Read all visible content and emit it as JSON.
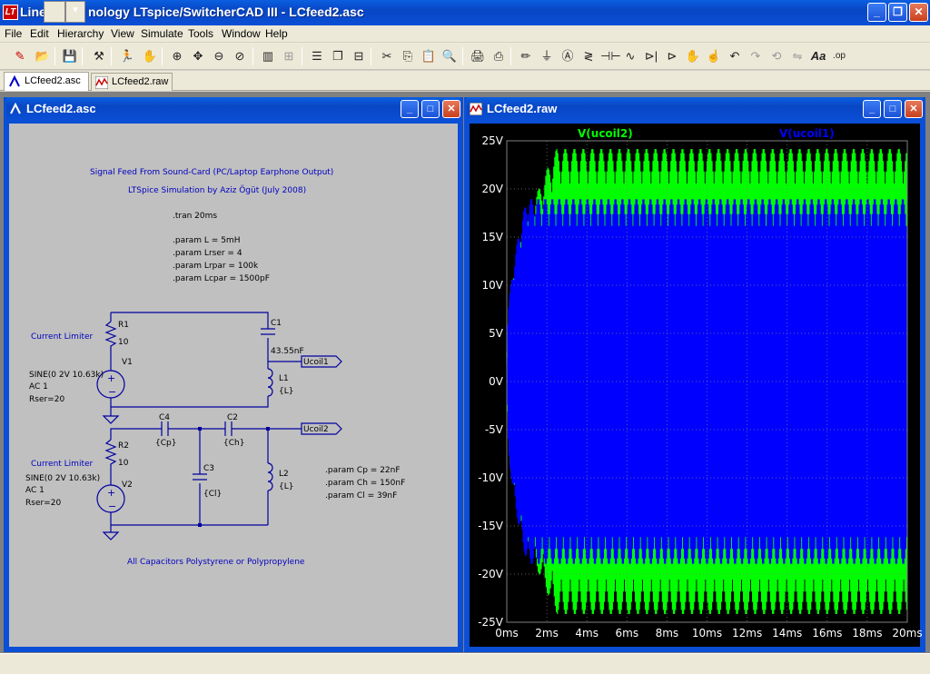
{
  "app": {
    "title_visible_start": "Line",
    "title_visible_end": "nology LTspice/SwitcherCAD III - LCfeed2.asc"
  },
  "menu": [
    "File",
    "Edit",
    "Hierarchy",
    "View",
    "Simulate",
    "Tools",
    "Window",
    "Help"
  ],
  "tabs": [
    {
      "label": "LCfeed2.asc",
      "active": true
    },
    {
      "label": "LCfeed2.raw",
      "active": false
    }
  ],
  "schematic_window": {
    "title": "LCfeed2.asc",
    "texts": {
      "header1": "Signal Feed From Sound-Card (PC/Laptop Earphone Output)",
      "header2": "LTSpice Simulation by Aziz Ögüt (July 2008)",
      "tran": ".tran 20ms",
      "param1": ".param L = 5mH",
      "param2": ".param Lrser = 4",
      "param3": ".param Lrpar = 100k",
      "param4": ".param Lcpar = 1500pF",
      "cl1": "Current Limiter",
      "r1": "R1",
      "r1v": "10",
      "c1": "C1",
      "c1v": "43.55nF",
      "v1": "V1",
      "l1": "L1",
      "l1v": "{L}",
      "sine1": "SINE(0 2V 10.63k)",
      "ac1": "AC 1",
      "rser1": "Rser=20",
      "ucoil1": "Ucoil1",
      "c4": "C4",
      "c4v": "{Cp}",
      "c2": "C2",
      "c2v": "{Ch}",
      "ucoil2": "Ucoil2",
      "cl2": "Current Limiter",
      "r2": "R2",
      "r2v": "10",
      "c3": "C3",
      "c3v": "{Cl}",
      "l2": "L2",
      "l2v": "{L}",
      "sine2": "SINE(0 2V 10.63k)",
      "v2": "V2",
      "ac2": "AC 1",
      "rser2": "Rser=20",
      "pcp": ".param Cp = 22nF",
      "pch": ".param Ch = 150nF",
      "pcl": ".param Cl  = 39nF",
      "footer": "All Capacitors Polystyrene or Polypropylene"
    }
  },
  "waveform_window": {
    "title": "LCfeed2.raw"
  },
  "colors": {
    "ucoil2": "#00ff00",
    "ucoil1": "#0000ff",
    "schematic_wire": "#0000a0",
    "schematic_text": "#0000c0"
  },
  "chart_data": {
    "type": "line",
    "xlabel": "",
    "ylabel": "",
    "x_ticks": [
      "0ms",
      "2ms",
      "4ms",
      "6ms",
      "8ms",
      "10ms",
      "12ms",
      "14ms",
      "16ms",
      "18ms",
      "20ms"
    ],
    "y_ticks": [
      "25V",
      "20V",
      "15V",
      "10V",
      "5V",
      "0V",
      "-5V",
      "-10V",
      "-15V",
      "-20V",
      "-25V"
    ],
    "xlim": [
      0,
      20
    ],
    "ylim": [
      -25,
      25
    ],
    "series": [
      {
        "name": "V(ucoil2)",
        "color": "#00ff00",
        "steady_amplitude": 24.2,
        "settle_ms": 2.5
      },
      {
        "name": "V(ucoil1)",
        "color": "#0000ff",
        "steady_amplitude": 19,
        "settle_ms": 1.0
      }
    ]
  }
}
